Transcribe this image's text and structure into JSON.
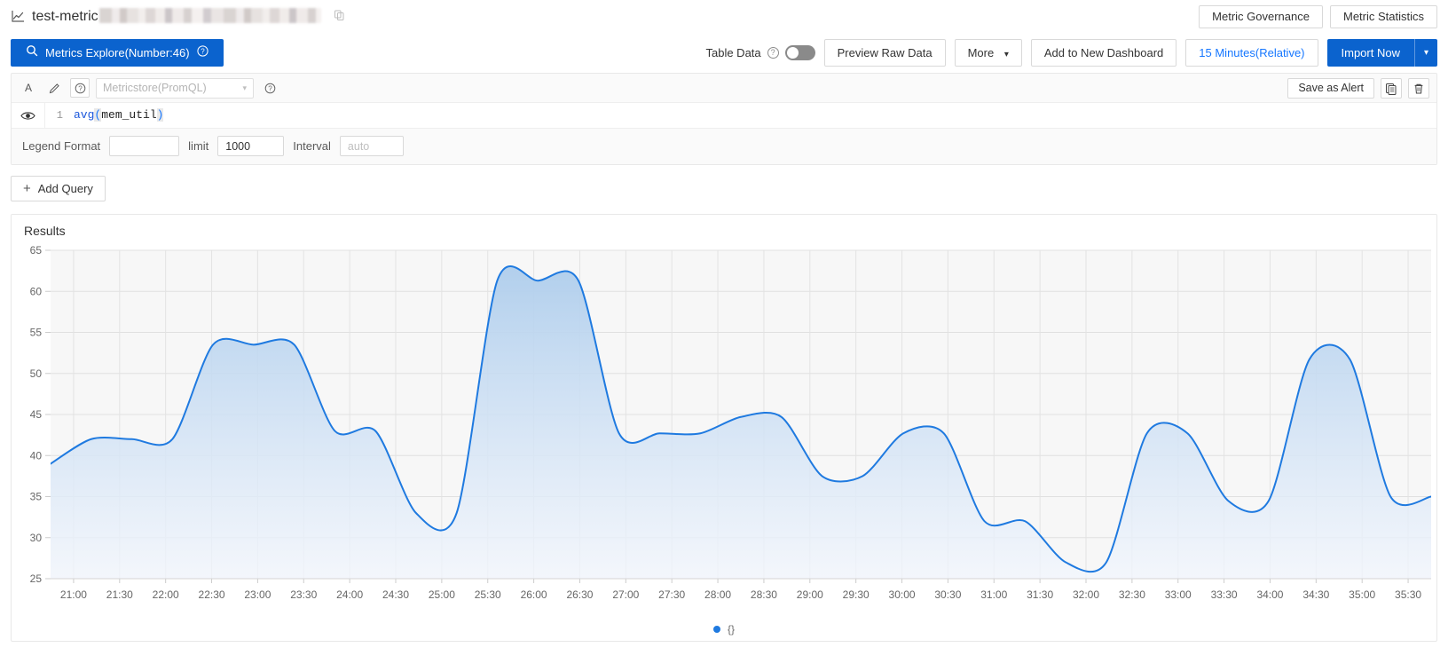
{
  "header": {
    "title": "test-metric",
    "title_redacted": true,
    "copy_icon": "copy-icon",
    "chart_icon": "line-chart-icon",
    "buttons": [
      {
        "label": "Metric Governance",
        "name": "metric-governance-button"
      },
      {
        "label": "Metric Statistics",
        "name": "metric-statistics-button"
      }
    ]
  },
  "actionbar": {
    "explore_label": "Metrics Explore(Number:46)",
    "explore_search_icon": "search-icon",
    "explore_help_icon": "question-circle-icon",
    "table_data_label": "Table Data",
    "table_data_help_icon": "question-circle-icon",
    "table_data_on": false,
    "preview_raw_data": "Preview Raw Data",
    "more": "More",
    "more_caret_icon": "chevron-down-icon",
    "add_to_new_dashboard": "Add to New Dashboard",
    "time_range": "15 Minutes(Relative)",
    "import_now": "Import Now",
    "import_caret_icon": "chevron-down-icon",
    "primary_color": "#0b63ce",
    "link_color": "#1677ff"
  },
  "query": {
    "letter": "A",
    "edit_icon": "pencil-icon",
    "help_icon": "question-circle-icon",
    "datasource_placeholder": "Metricstore(PromQL)",
    "datasource_caret_icon": "chevron-down-icon",
    "datasource_help_icon": "question-circle-icon",
    "save_as_alert": "Save as Alert",
    "copy_icon": "copy-icon",
    "delete_icon": "trash-icon",
    "eye_icon": "eye-icon",
    "line_number": "1",
    "expression": "avg(mem_util)",
    "expr_tokens": {
      "fn": "avg",
      "open": "(",
      "arg": "mem_util",
      "close": ")"
    },
    "legend_format_label": "Legend Format",
    "legend_format_value": "",
    "limit_label": "limit",
    "limit_value": "1000",
    "interval_label": "Interval",
    "interval_placeholder": "auto",
    "add_query_label": "Add Query",
    "add_query_icon": "plus-icon"
  },
  "results": {
    "title": "Results",
    "legend_label": "{}",
    "legend_color": "#1f7ae0"
  },
  "chart_data": {
    "type": "area",
    "title": "Results",
    "xlabel": "",
    "ylabel": "",
    "grid": true,
    "legend_position": "bottom",
    "line_color": "#1f7ae0",
    "fill_top": "#aecdec",
    "fill_bottom": "#f2f6fd",
    "series": [
      {
        "name": "{}",
        "values": [
          39.0,
          42.0,
          42.0,
          42.0,
          53.5,
          53.5,
          53.5,
          43.0,
          43.0,
          33.0,
          33.0,
          61.3,
          61.3,
          61.3,
          42.7,
          42.7,
          42.7,
          44.7,
          44.7,
          37.5,
          37.5,
          42.7,
          42.7,
          32.0,
          32.0,
          27.0,
          27.0,
          42.7,
          42.7,
          34.5,
          34.5,
          51.7,
          51.7,
          35.0,
          35.0
        ]
      }
    ],
    "x": [
      "21:00",
      "21:30",
      "22:00",
      "22:30",
      "23:00",
      "23:30",
      "24:00",
      "24:30",
      "25:00",
      "25:30",
      "26:00",
      "26:30",
      "27:00",
      "27:30",
      "28:00",
      "28:30",
      "29:00",
      "29:30",
      "30:00",
      "30:30",
      "31:00",
      "31:30",
      "32:00",
      "32:30",
      "33:00",
      "33:30",
      "34:00",
      "34:30",
      "35:00",
      "35:30"
    ],
    "ytick_labels": [
      "65",
      "60",
      "55",
      "50",
      "45",
      "40",
      "35",
      "30",
      "25"
    ],
    "ylim": [
      25,
      65
    ],
    "xtick_labels": [
      "21:00",
      "21:30",
      "22:00",
      "22:30",
      "23:00",
      "23:30",
      "24:00",
      "24:30",
      "25:00",
      "25:30",
      "26:00",
      "26:30",
      "27:00",
      "27:30",
      "28:00",
      "28:30",
      "29:00",
      "29:30",
      "30:00",
      "30:30",
      "31:00",
      "31:30",
      "32:00",
      "32:30",
      "33:00",
      "33:30",
      "34:00",
      "34:30",
      "35:00",
      "35:30"
    ]
  }
}
